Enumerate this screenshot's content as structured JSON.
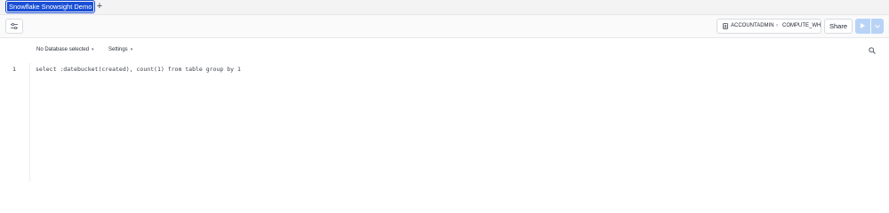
{
  "tabs": [
    {
      "label": "Snowflake Snowsight Demo",
      "active": true
    }
  ],
  "tab_add_label": "+",
  "toolbar": {
    "filter_icon": "sliders-icon",
    "role": "ACCOUNTADMIN",
    "separator": "›",
    "warehouse": "COMPUTE_WH",
    "share_label": "Share",
    "run_icon": "play-icon",
    "run_menu_icon": "chevron-down-icon"
  },
  "editor": {
    "database_label": "No Database selected",
    "settings_label": "Settings",
    "dropdown_caret": "▾",
    "search_icon": "search-icon",
    "lines": [
      {
        "number": "1",
        "code": "select :datebucket(created), count(1) from table group by 1"
      }
    ]
  },
  "colors": {
    "accent": "#1a4fd6",
    "run_button": "#b9d3f7",
    "tabbar_bg": "#f3f3f4"
  }
}
